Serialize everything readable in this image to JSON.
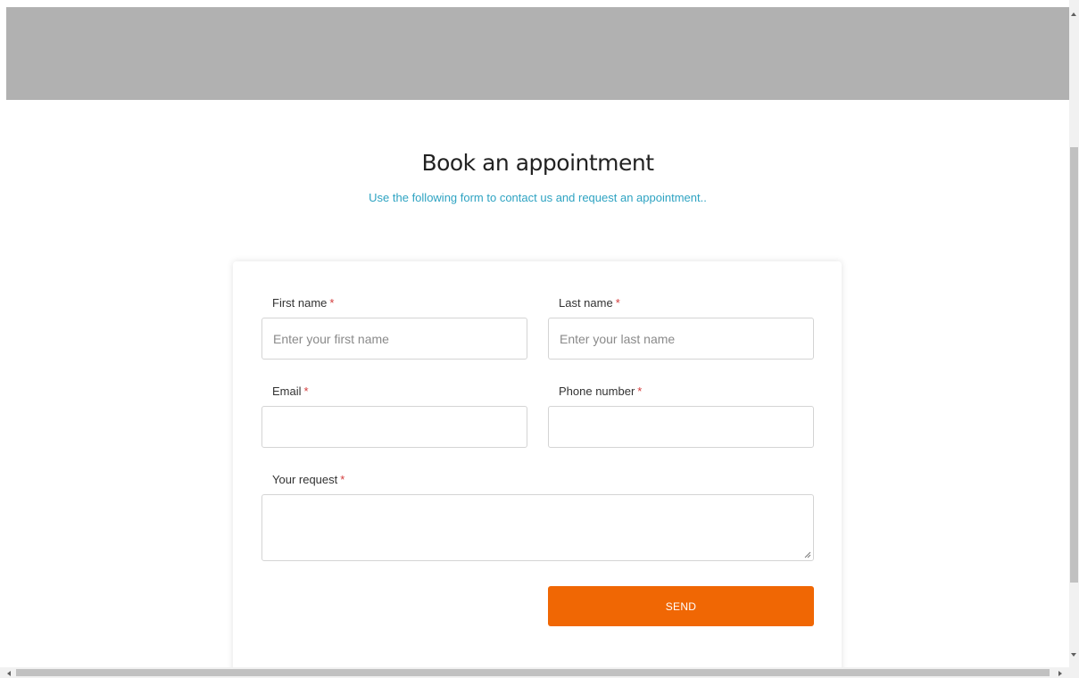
{
  "header": {
    "title": "Book an appointment",
    "subtitle": "Use the following form to contact us and request an appointment.."
  },
  "form": {
    "required_marker": "*",
    "first_name": {
      "label": "First name",
      "placeholder": "Enter your first name",
      "value": ""
    },
    "last_name": {
      "label": "Last name",
      "placeholder": "Enter your last name",
      "value": ""
    },
    "email": {
      "label": "Email",
      "placeholder": "",
      "value": ""
    },
    "phone": {
      "label": "Phone number",
      "placeholder": "",
      "value": ""
    },
    "request": {
      "label": "Your request",
      "value": ""
    },
    "send_label": "SEND"
  },
  "colors": {
    "banner": "#b1b1b1",
    "subtitle": "#2ea3c2",
    "required": "#d33c3c",
    "send_button": "#f06704"
  },
  "icons": {
    "resize": "textarea-resize-grip-icon",
    "scroll_up": "chevron-up-icon",
    "scroll_down": "chevron-down-icon",
    "scroll_left": "chevron-left-icon",
    "scroll_right": "chevron-right-icon"
  }
}
